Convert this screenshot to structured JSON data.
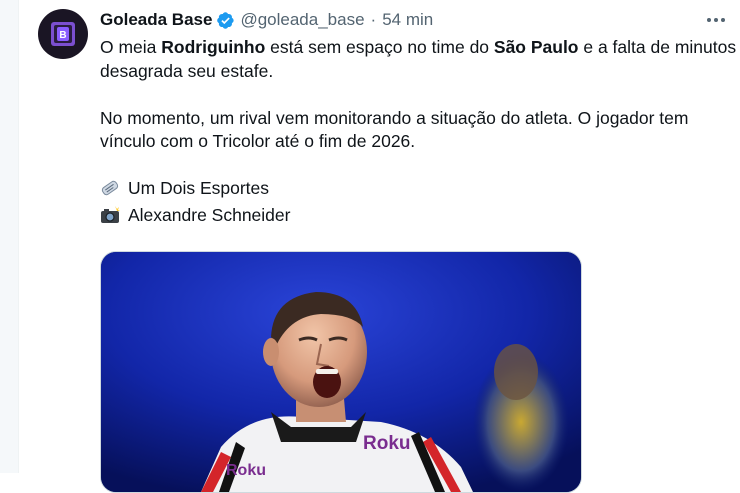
{
  "tweet": {
    "display_name": "Goleada Base",
    "handle": "@goleada_base",
    "separator": "·",
    "time": "54 min",
    "p1_a": "O meia ",
    "p1_b": "Rodriguinho",
    "p1_c": " está sem espaço no time do ",
    "p1_d": "São Paulo",
    "p1_e": " e a falta de minutos desagrada seu estafe.",
    "p2": "No momento, um rival vem monitorando a situação do atleta. O jogador tem vínculo com o Tricolor até o fim de 2026.",
    "source_line": "Um Dois Esportes",
    "photo_line": "Alexandre Schneider",
    "media_text": "Roku"
  },
  "colors": {
    "text": "#0f1419",
    "muted": "#536471",
    "verified": "#1d9bf0",
    "media_bg": "#0a1a78"
  },
  "icons": {
    "verified": "verified-badge-icon",
    "more": "more-options-icon",
    "newspaper": "newspaper-emoji-icon",
    "camera": "camera-flash-emoji-icon"
  }
}
